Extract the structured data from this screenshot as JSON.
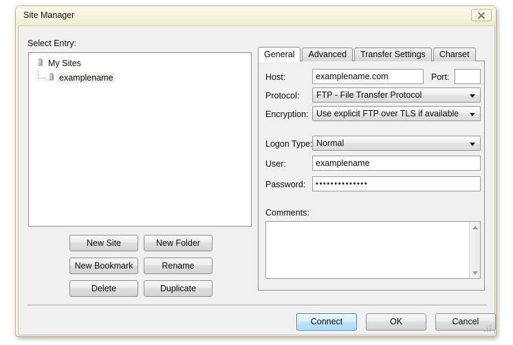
{
  "window": {
    "title": "Site Manager",
    "close_label": "close-icon"
  },
  "left": {
    "select_entry_label": "Select Entry:",
    "tree": [
      {
        "label": "My Sites",
        "icon": "server-icon",
        "level": 0
      },
      {
        "label": "examplename",
        "icon": "server-icon",
        "level": 1,
        "selected": true
      }
    ],
    "buttons": [
      {
        "label": "New Site"
      },
      {
        "label": "New Folder"
      },
      {
        "label": "New Bookmark"
      },
      {
        "label": "Rename"
      },
      {
        "label": "Delete"
      },
      {
        "label": "Duplicate"
      }
    ]
  },
  "right": {
    "tabs": [
      {
        "label": "General",
        "active": true
      },
      {
        "label": "Advanced",
        "active": false
      },
      {
        "label": "Transfer Settings",
        "active": false
      },
      {
        "label": "Charset",
        "active": false
      }
    ],
    "general": {
      "host_label": "Host:",
      "host_value": "examplename.com",
      "port_label": "Port:",
      "port_value": "",
      "protocol_label": "Protocol:",
      "protocol_value": "FTP - File Transfer Protocol",
      "encryption_label": "Encryption:",
      "encryption_value": "Use explicit FTP over TLS if available",
      "logon_type_label": "Logon Type:",
      "logon_type_value": "Normal",
      "user_label": "User:",
      "user_value": "examplename",
      "password_label": "Password:",
      "password_value": "••••••••••••••",
      "comments_label": "Comments:",
      "comments_value": ""
    }
  },
  "footer": {
    "connect_label": "Connect",
    "ok_label": "OK",
    "cancel_label": "Cancel"
  },
  "colors": {
    "title_bar": "#f6f4de",
    "dialog_bg": "#f0f0f0",
    "default_button_border": "#3c7fb1",
    "field_border": "#9b9b9b"
  }
}
